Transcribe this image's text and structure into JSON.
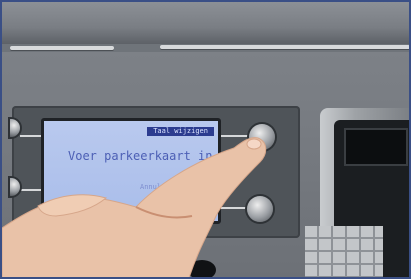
{
  "photo": {
    "screen": {
      "header": "Taal wijzigen",
      "message": "Voer parkeerkaart in",
      "footer": "Annuleren"
    }
  }
}
